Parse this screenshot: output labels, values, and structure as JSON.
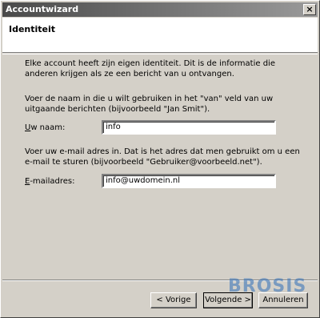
{
  "window": {
    "title": "Accountwizard",
    "close_symbol": "×"
  },
  "header": {
    "title": "Identiteit"
  },
  "body": {
    "intro": "Elke account heeft zijn eigen identiteit. Dit is de informatie die anderen krijgen als ze een bericht van u ontvangen.",
    "name_instruction": "Voer de naam in die u wilt gebruiken in het \"van\" veld van uw uitgaande berichten (bijvoorbeeld \"Jan Smit\").",
    "name_label_access": "U",
    "name_label_rest": "w naam:",
    "name_value": "info",
    "email_instruction": "Voer uw e-mail adres in. Dat is het adres dat men gebruikt om u een e-mail te sturen (bijvoorbeeld \"Gebruiker@voorbeeld.net\").",
    "email_label_access": "E",
    "email_label_rest": "-mailadres:",
    "email_value": "info@uwdomein.nl"
  },
  "footer": {
    "back_label": "< Vorige",
    "next_label": "Volgende >",
    "cancel_label": "Annuleren"
  },
  "watermark": {
    "text": "BROSIS"
  },
  "colors": {
    "dialog_bg": "#d4d0c8",
    "titlebar_start": "#4a4a4a",
    "titlebar_end": "#9a9a9a",
    "watermark": "#2f6fb8"
  }
}
